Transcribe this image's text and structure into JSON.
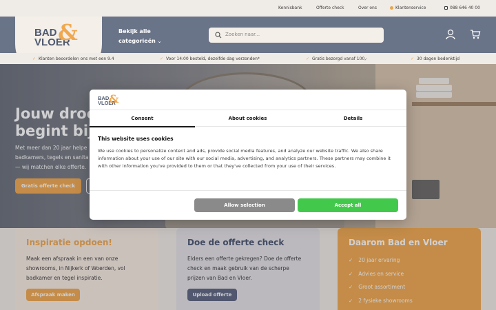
{
  "topbar": {
    "links": [
      "Kennisbank",
      "Offerte check",
      "Over ons"
    ],
    "service": "Klantenservice",
    "phone": "088 646 40 00"
  },
  "header": {
    "logo_line1": "BAD",
    "logo_line2": "VLOER",
    "categories_line1": "Bekijk alle",
    "categories_line2": "categorieën",
    "search_placeholder": "Zoeken naar..."
  },
  "usps": [
    "Klanten beoordelen ons met een 9.4",
    "Voor 14:00 besteld, dezelfde dag verzonden*",
    "Gratis bezorgd vanaf 100,-",
    "30 dagen bedenktijd"
  ],
  "hero": {
    "title_line1": "Jouw droo",
    "title_line2": "begint bij",
    "text_line1": "Met meer dan 20 jaar helpe",
    "text_line2": "badkamers, tegels en sanita",
    "text_line3": "— wij matchen elke offerte.",
    "cta": "Gratis offerte check"
  },
  "cards": {
    "inspiration": {
      "title": "Inspiratie opdoen!",
      "line1": "Maak een afspraak in een van onze",
      "line2": "showrooms, in Nijkerk of Woerden, vol",
      "line3": "badkamer en tegel inspiratie.",
      "button": "Afspraak maken"
    },
    "offer": {
      "title": "Doe de offerte check",
      "line1": "Elders een offerte gekregen? Doe de offerte",
      "line2": "check en maak gebruik van de scherpe",
      "line3": "prijzen van Bad en Vloer.",
      "button": "Upload offerte"
    },
    "why": {
      "title": "Daarom Bad en Vloer",
      "items": [
        "20 jaar ervaring",
        "Advies en service",
        "Groot assortiment",
        "2 fysieke showrooms"
      ]
    }
  },
  "cookie_dialog": {
    "tabs": [
      "Consent",
      "About cookies",
      "Details"
    ],
    "title": "This website uses cookies",
    "body": "We use cookies to personalize content and ads, provide social media features, and analyze our website traffic. We also share information about your use of our site with our social media, advertising, and analytics partners. These partners may combine it with other information you've provided to them or that they've collected from your use of their services.",
    "allow_selection": "Allow selection",
    "accept_all": "Accept all"
  },
  "colors": {
    "brand_blue": "#6a7488",
    "brand_orange": "#f0a84f",
    "accept_green": "#42c94b"
  }
}
